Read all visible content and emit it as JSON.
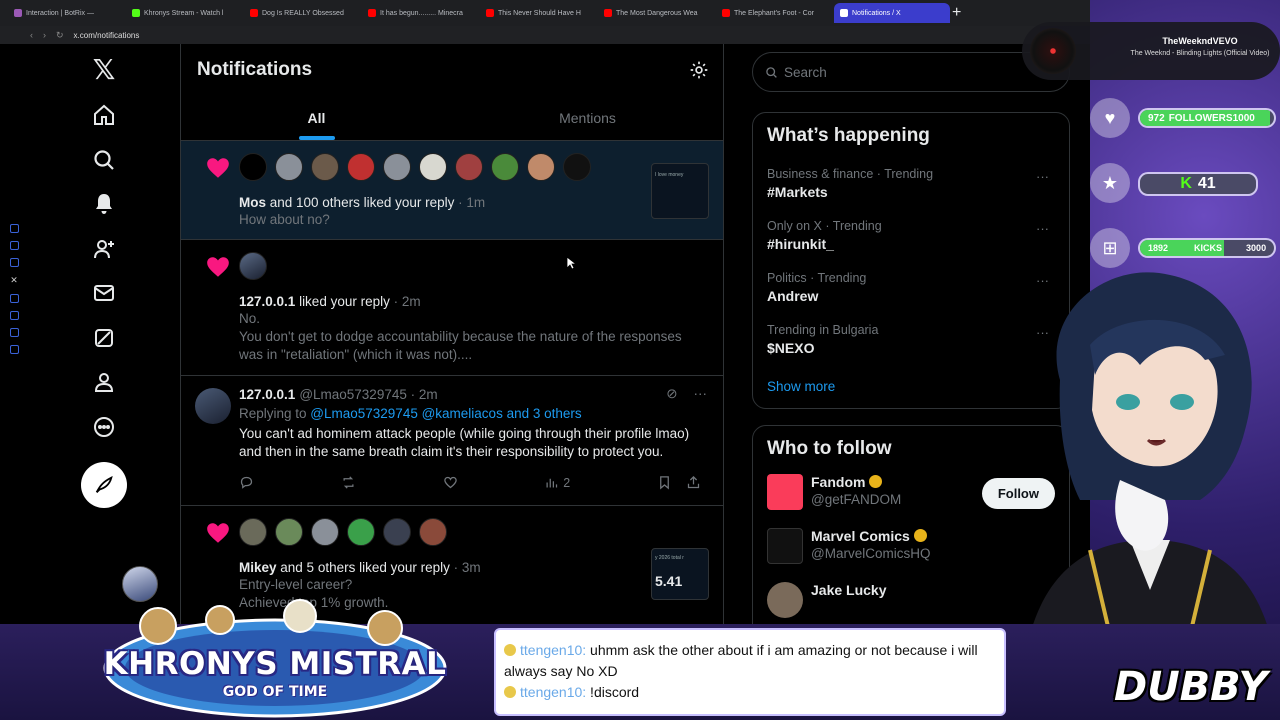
{
  "browser": {
    "tabs": [
      {
        "label": "Interaction | BotRix —",
        "color": "#9b59b6"
      },
      {
        "label": "Khronys Stream - Watch l",
        "color": "#53fc18"
      },
      {
        "label": "Dog Is REALLY Obsessed",
        "color": "#ff0000"
      },
      {
        "label": "It has begun......... Minecra",
        "color": "#ff0000"
      },
      {
        "label": "This Never Should Have H",
        "color": "#ff0000"
      },
      {
        "label": "The Most Dangerous Wea",
        "color": "#ff0000"
      },
      {
        "label": "The Elephant's Foot - Cor",
        "color": "#ff0000"
      },
      {
        "label": "Notifications / X",
        "color": "#ffffff"
      }
    ],
    "url": "x.com/notifications"
  },
  "x": {
    "logo": "𝕏",
    "nav_icons": [
      "home-icon",
      "search-icon",
      "bell-icon",
      "person-add-icon",
      "mail-icon",
      "grok-icon",
      "profile-icon",
      "more-icon"
    ],
    "header_title": "Notifications",
    "tabs": [
      "All",
      "Mentions"
    ],
    "notif1": {
      "user": "Mos",
      "text": " and 100 others liked your reply",
      "time": " · 1m",
      "sub": "How about no?",
      "thumb": "I love money"
    },
    "notif2": {
      "user": "127.0.0.1",
      "text": " liked your reply",
      "time": " · 2m",
      "line1": "No.",
      "line2": "You don't get to dodge accountability because the nature of the responses",
      "line3": "was in \"retaliation\" (which it was not)...."
    },
    "tweet": {
      "name": "127.0.0.1",
      "handle": "@Lmao57329745 · 2m",
      "replying_prefix": "Replying to ",
      "replying_to": "@Lmao57329745 @kameliacos and 3 others",
      "body1": "You can't ad hominem attack people (while going through their profile lmao)",
      "body2": "and then in the same breath claim it's their responsibility to protect you.",
      "views": "2"
    },
    "notif3": {
      "user": "Mikey",
      "text": " and 5 others liked your reply",
      "time": " · 3m",
      "line1": "Entry-level career?",
      "line2": "Achieved top 1% growth.",
      "thumb_top": "y 2026 total r",
      "thumb_val": "5.41"
    },
    "search_placeholder": "Search",
    "whats_happening": {
      "title": "What’s happening",
      "trends": [
        {
          "meta": "Business & finance · Trending",
          "name": "#Markets"
        },
        {
          "meta": "Only on X · Trending",
          "name": "#hirunkit_"
        },
        {
          "meta": "Politics · Trending",
          "name": "Andrew"
        },
        {
          "meta": "Trending in Bulgaria",
          "name": "$NEXO"
        }
      ],
      "show_more": "Show more"
    },
    "who_to_follow": {
      "title": "Who to follow",
      "accounts": [
        {
          "name": "Fandom",
          "handle": "@getFANDOM",
          "button": "Follow"
        },
        {
          "name": "Marvel Comics",
          "handle": "@MarvelComicsHQ"
        },
        {
          "name": "Jake Lucky"
        }
      ]
    }
  },
  "overlay": {
    "now_playing_artist": "TheWeekndVEVO",
    "now_playing_song": "The Weeknd - Blinding Lights (Official Video)",
    "followers_current": "972",
    "followers_label": "FOLLOWERS",
    "followers_goal": "1000",
    "followers_progress": 0.97,
    "kick_count": "41",
    "kicks_current": "1892",
    "kicks_label": "KICKS",
    "kicks_goal": "3000",
    "kicks_progress": 0.63,
    "brand_title": "KHRONYS MISTRAL",
    "brand_sub": "GOD OF TIME",
    "chat": [
      {
        "user": "ttengen10:",
        "text": " uhmm ask the other about if i am amazing or not because i will always say No XD"
      },
      {
        "user": "ttengen10:",
        "text": " !discord"
      }
    ],
    "streamer_tag": "DUBBY"
  }
}
